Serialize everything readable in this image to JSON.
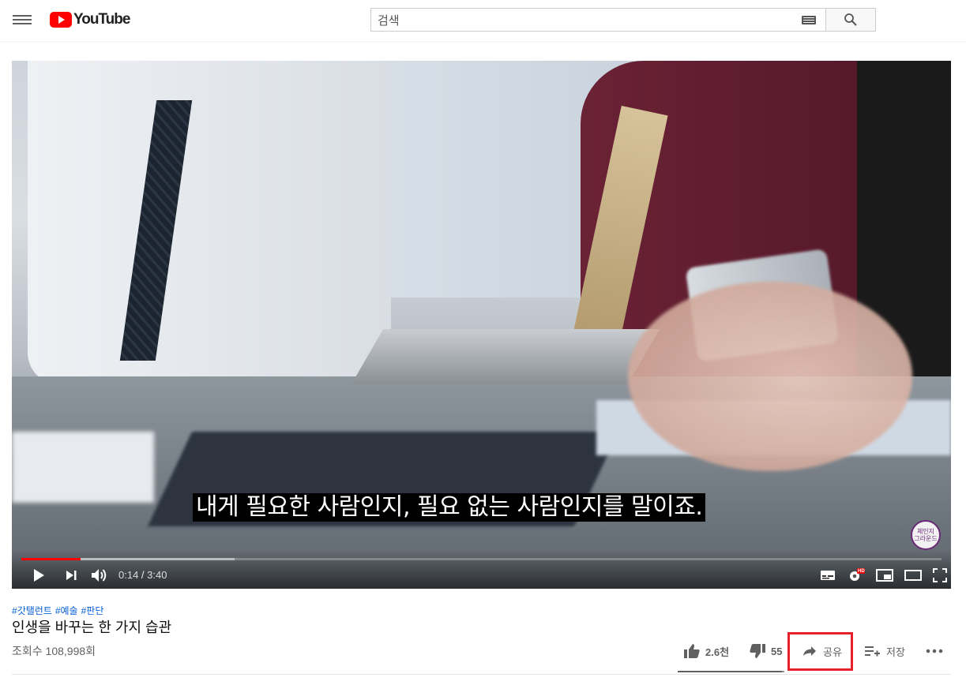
{
  "header": {
    "logo_text": "YouTube",
    "search_placeholder": "검색",
    "icons": [
      "menu-icon",
      "keyboard-icon",
      "search-icon"
    ]
  },
  "player": {
    "subtitle": "내게 필요한 사람인지, 필요 없는 사람인지를 말이죠.",
    "watermark": "체인지\n그라운드",
    "time_current": "0:14",
    "time_total": "3:40",
    "progress_played_fraction": 0.064,
    "progress_buffered_fraction": 0.232,
    "hd_badge": "HD",
    "controls": [
      "play-icon",
      "next-icon",
      "volume-icon",
      "subtitles-icon",
      "settings-icon",
      "miniplayer-icon",
      "theater-icon",
      "fullscreen-icon"
    ]
  },
  "info": {
    "hashtags": [
      "#갓탤런트",
      "#예술",
      "#판단"
    ],
    "title": "인생을 바꾸는 한 가지 습관",
    "views": "조회수 108,998회"
  },
  "actions": {
    "like_count": "2.6천",
    "dislike_count": "55",
    "share_label": "공유",
    "save_label": "저장",
    "like_fraction": 0.979
  },
  "colors": {
    "brand_red": "#ff0000",
    "highlight_box": "#e8202a",
    "link_blue": "#065fd4"
  }
}
